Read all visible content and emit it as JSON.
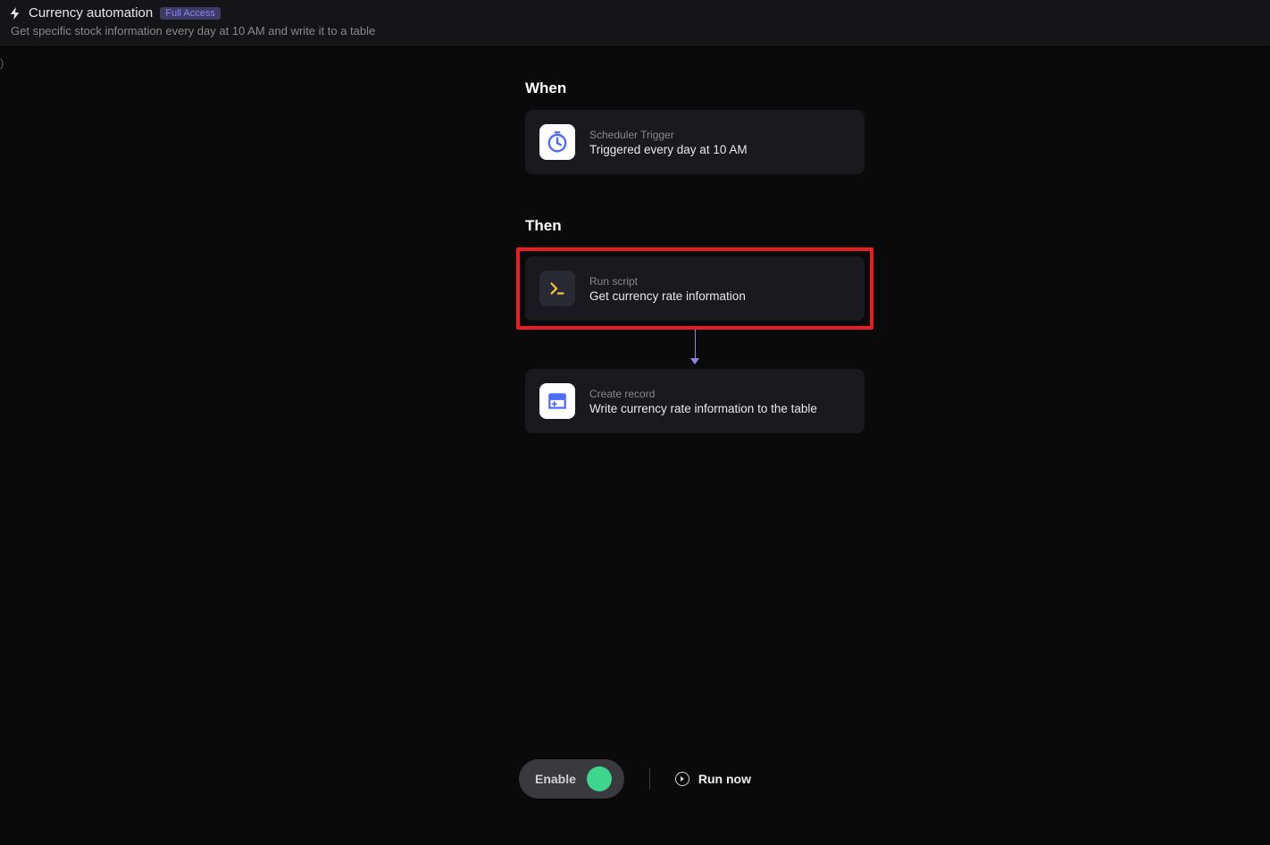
{
  "header": {
    "title": "Currency automation",
    "badge": "Full Access",
    "subtitle": "Get specific stock information every day at 10 AM and write it to a table"
  },
  "flow": {
    "when_label": "When",
    "then_label": "Then",
    "trigger": {
      "type": "Scheduler Trigger",
      "desc": "Triggered every day at 10 AM"
    },
    "actions": [
      {
        "type": "Run script",
        "desc": "Get currency rate information",
        "highlighted": true,
        "icon": "terminal"
      },
      {
        "type": "Create record",
        "desc": "Write currency rate information to the table",
        "highlighted": false,
        "icon": "table"
      }
    ]
  },
  "footer": {
    "enable_label": "Enable",
    "run_now_label": "Run now"
  }
}
